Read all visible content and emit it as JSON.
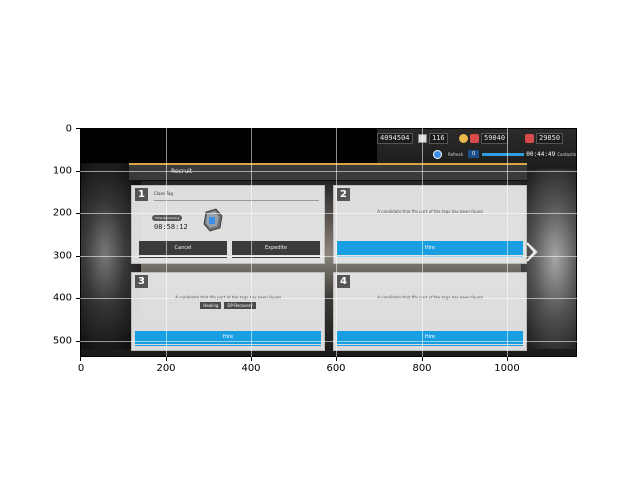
{
  "resources": {
    "lmd": "4094504",
    "cards": "116",
    "originium": "59040",
    "orundum": "29850"
  },
  "status": {
    "label": "Refresh",
    "count": "0",
    "time": "00:44:49",
    "state": "Contacting"
  },
  "recruit": {
    "title": "Recruit"
  },
  "slots": [
    {
      "number": "1",
      "tag_label": "Close Tag",
      "time_remaining_label": "Time Remaining",
      "time_remaining": "08:58:12",
      "cancel_label": "Cancel",
      "expedite_label": "Expedite"
    },
    {
      "number": "2",
      "message": "A candidate that fits part of the tags has been found",
      "hire_label": "Hire"
    },
    {
      "number": "3",
      "message": "A candidate that fits part of the tags has been found",
      "tags": [
        "Healing",
        "DP-Recovery"
      ],
      "hire_label": "Hire"
    },
    {
      "number": "4",
      "message": "A candidate that fits part of the tags has been found",
      "hire_label": "Hire"
    }
  ],
  "axes": {
    "x_ticks": [
      "0",
      "200",
      "400",
      "600",
      "800",
      "1000"
    ],
    "y_ticks": [
      "0",
      "100",
      "200",
      "300",
      "400",
      "500"
    ]
  },
  "icons": {
    "next": "chevron-right-icon",
    "device": "recruit-device-icon",
    "refresh": "refresh-icon"
  },
  "colors": {
    "accent_blue": "#1a9ee2",
    "header_gold": "#d9a441",
    "button_dark": "#3b3b3b"
  }
}
